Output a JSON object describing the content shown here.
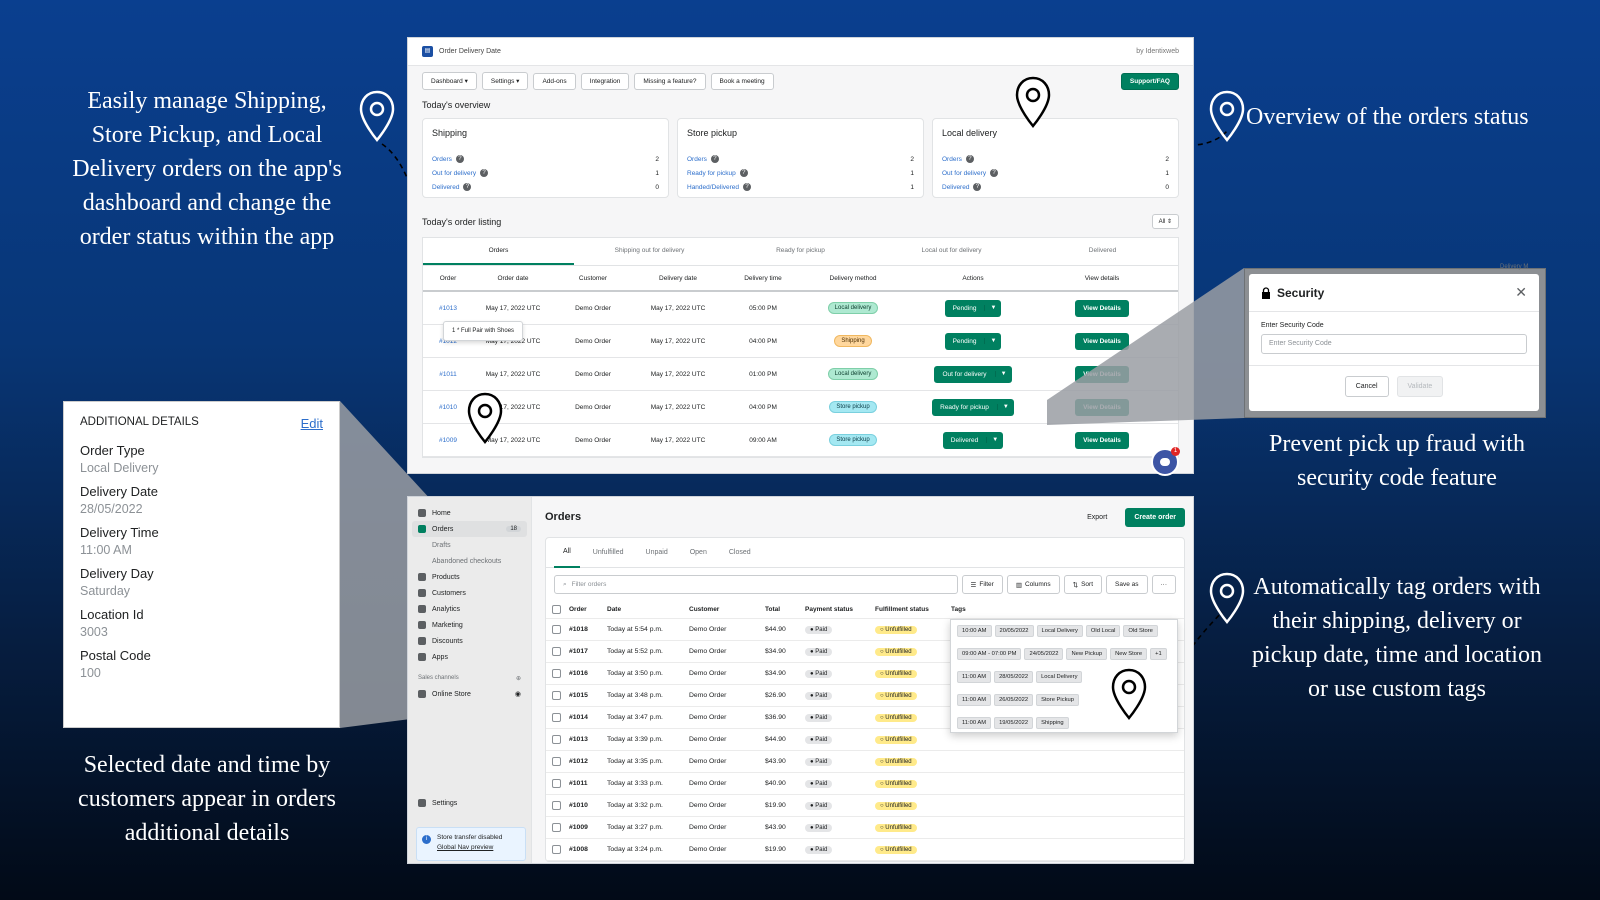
{
  "captions": {
    "top_left": "Easily manage Shipping, Store Pickup, and Local Delivery orders on the app's dashboard and change the order status within the app",
    "top_right": "Overview of the orders status",
    "mid_right": "Prevent pick up fraud with security code feature",
    "bottom_right": "Automatically tag orders with their shipping, delivery or pickup date, time and location or use custom tags",
    "bottom_left": "Selected date and time by customers appear in orders additional details"
  },
  "app": {
    "title": "Order Delivery Date",
    "by": "by Identixweb",
    "nav": [
      "Dashboard ▾",
      "Settings ▾",
      "Add-ons",
      "Integration",
      "Missing a feature?",
      "Book a meeting"
    ],
    "support": "Support/FAQ",
    "overview_title": "Today's overview",
    "cards": [
      {
        "title": "Shipping",
        "lines": [
          {
            "label": "Orders",
            "value": "2"
          },
          {
            "label": "Out for delivery",
            "value": "1"
          },
          {
            "label": "Delivered",
            "value": "0"
          }
        ]
      },
      {
        "title": "Store pickup",
        "lines": [
          {
            "label": "Orders",
            "value": "2"
          },
          {
            "label": "Ready for pickup",
            "value": "1"
          },
          {
            "label": "Handed/Delivered",
            "value": "1"
          }
        ]
      },
      {
        "title": "Local delivery",
        "lines": [
          {
            "label": "Orders",
            "value": "2"
          },
          {
            "label": "Out for delivery",
            "value": "1"
          },
          {
            "label": "Delivered",
            "value": "0"
          }
        ]
      }
    ],
    "listing_title": "Today's order listing",
    "listing_filter": "All ⇕",
    "tabs": [
      "Orders",
      "Shipping out for delivery",
      "Ready for pickup",
      "Local out for delivery",
      "Delivered"
    ],
    "columns": [
      "Order",
      "Order date",
      "Customer",
      "Delivery date",
      "Delivery time",
      "Delivery method",
      "Actions",
      "View details"
    ],
    "rows": [
      {
        "order": "#1013",
        "date": "May 17, 2022 UTC",
        "customer": "Demo Order",
        "ddate": "May 17, 2022 UTC",
        "time": "05:00 PM",
        "method": "Local delivery",
        "action": "Pending",
        "view": "View Details"
      },
      {
        "order": "#1012",
        "date": "May 17, 2022 UTC",
        "customer": "Demo Order",
        "ddate": "May 17, 2022 UTC",
        "time": "04:00 PM",
        "method": "Shipping",
        "action": "Pending",
        "view": "View Details"
      },
      {
        "order": "#1011",
        "date": "May 17, 2022 UTC",
        "customer": "Demo Order",
        "ddate": "May 17, 2022 UTC",
        "time": "01:00 PM",
        "method": "Local delivery",
        "action": "Out for delivery",
        "view": "View Details"
      },
      {
        "order": "#1010",
        "date": "May 17, 2022 UTC",
        "customer": "Demo Order",
        "ddate": "May 17, 2022 UTC",
        "time": "04:00 PM",
        "method": "Store pickup",
        "action": "Ready for pickup",
        "view": "View Details"
      },
      {
        "order": "#1009",
        "date": "May 17, 2022 UTC",
        "customer": "Demo Order",
        "ddate": "May 17, 2022 UTC",
        "time": "09:00 AM",
        "method": "Store pickup",
        "action": "Delivered",
        "view": "View Details"
      }
    ],
    "tooltip": "1 * Full Pair with Shoes",
    "chat_badge": "1"
  },
  "security": {
    "title": "Security",
    "label": "Enter Security Code",
    "placeholder": "Enter Security Code",
    "cancel": "Cancel",
    "validate": "Validate",
    "bg_text": "Delivery M"
  },
  "additional": {
    "title": "Additional details",
    "edit": "Edit",
    "fields": [
      {
        "label": "Order Type",
        "value": "Local Delivery"
      },
      {
        "label": "Delivery Date",
        "value": "28/05/2022"
      },
      {
        "label": "Delivery Time",
        "value": "11:00 AM"
      },
      {
        "label": "Delivery Day",
        "value": "Saturday"
      },
      {
        "label": "Location Id",
        "value": "3003"
      },
      {
        "label": "Postal Code",
        "value": "100"
      }
    ]
  },
  "shop": {
    "sidebar": [
      {
        "label": "Home"
      },
      {
        "label": "Orders",
        "count": "18"
      },
      {
        "label": "Drafts",
        "sub": true
      },
      {
        "label": "Abandoned checkouts",
        "sub": true
      },
      {
        "label": "Products"
      },
      {
        "label": "Customers"
      },
      {
        "label": "Analytics"
      },
      {
        "label": "Marketing"
      },
      {
        "label": "Discounts"
      },
      {
        "label": "Apps"
      }
    ],
    "channels_label": "Sales channels",
    "online_store": "Online Store",
    "settings": "Settings",
    "note_line1": "Store transfer disabled",
    "note_line2": "Global Nav preview",
    "title": "Orders",
    "export": "Export",
    "create": "Create order",
    "tabs": [
      "All",
      "Unfulfilled",
      "Unpaid",
      "Open",
      "Closed"
    ],
    "filter_placeholder": "Filter orders",
    "buttons": [
      "Filter",
      "Columns",
      "Sort",
      "Save as",
      "···"
    ],
    "columns": [
      "Order",
      "Date",
      "Customer",
      "Total",
      "Payment status",
      "Fulfillment status",
      "Tags"
    ],
    "rows": [
      {
        "order": "#1018",
        "date": "Today at 5:54 p.m.",
        "customer": "Demo Order",
        "total": "$44.90",
        "pay": "Paid",
        "ful": "Unfulfilled"
      },
      {
        "order": "#1017",
        "date": "Today at 5:52 p.m.",
        "customer": "Demo Order",
        "total": "$34.90",
        "pay": "Paid",
        "ful": "Unfulfilled"
      },
      {
        "order": "#1016",
        "date": "Today at 3:50 p.m.",
        "customer": "Demo Order",
        "total": "$34.90",
        "pay": "Paid",
        "ful": "Unfulfilled"
      },
      {
        "order": "#1015",
        "date": "Today at 3:48 p.m.",
        "customer": "Demo Order",
        "total": "$26.90",
        "pay": "Paid",
        "ful": "Unfulfilled"
      },
      {
        "order": "#1014",
        "date": "Today at 3:47 p.m.",
        "customer": "Demo Order",
        "total": "$36.90",
        "pay": "Paid",
        "ful": "Unfulfilled"
      },
      {
        "order": "#1013",
        "date": "Today at 3:39 p.m.",
        "customer": "Demo Order",
        "total": "$44.90",
        "pay": "Paid",
        "ful": "Unfulfilled"
      },
      {
        "order": "#1012",
        "date": "Today at 3:35 p.m.",
        "customer": "Demo Order",
        "total": "$43.90",
        "pay": "Paid",
        "ful": "Unfulfilled"
      },
      {
        "order": "#1011",
        "date": "Today at 3:33 p.m.",
        "customer": "Demo Order",
        "total": "$40.90",
        "pay": "Paid",
        "ful": "Unfulfilled"
      },
      {
        "order": "#1010",
        "date": "Today at 3:32 p.m.",
        "customer": "Demo Order",
        "total": "$19.90",
        "pay": "Paid",
        "ful": "Unfulfilled"
      },
      {
        "order": "#1009",
        "date": "Today at 3:27 p.m.",
        "customer": "Demo Order",
        "total": "$43.90",
        "pay": "Paid",
        "ful": "Unfulfilled"
      },
      {
        "order": "#1008",
        "date": "Today at 3:24 p.m.",
        "customer": "Demo Order",
        "total": "$19.90",
        "pay": "Paid",
        "ful": "Unfulfilled"
      }
    ],
    "tags": [
      [
        "10:00 AM",
        "20/05/2022",
        "Local Delivery",
        "Old Local",
        "Old Store"
      ],
      [
        "09:00 AM - 07:00 PM",
        "24/05/2022",
        "New Pickup",
        "New Store",
        "+1"
      ],
      [
        "11:00 AM",
        "28/05/2022",
        "Local Delivery"
      ],
      [
        "11:00 AM",
        "26/05/2022",
        "Store Pickup"
      ],
      [
        "11:00 AM",
        "19/05/2022",
        "Shipping"
      ]
    ]
  }
}
